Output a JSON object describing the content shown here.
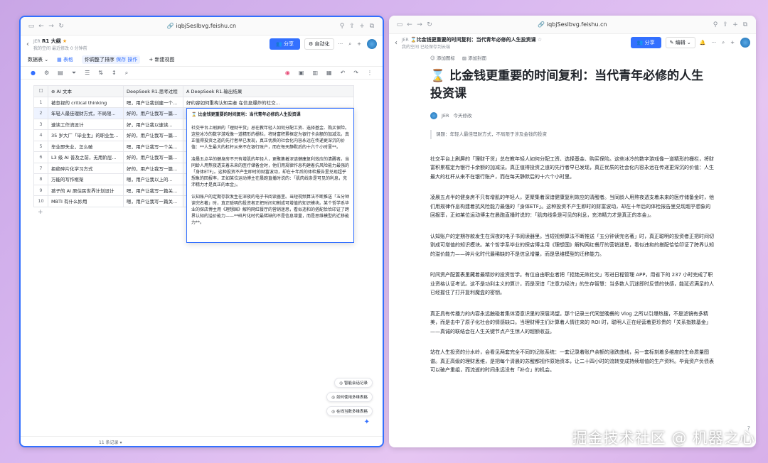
{
  "left": {
    "url": "iqbjSeslbvg.feishu.cn",
    "title": "R1 大纲",
    "crumb1": "JER",
    "crumb2": "最近修改 0 分钟前",
    "crumb3": "我的空间",
    "share": "分享",
    "automation": "自动化",
    "db_label": "数据表",
    "view": "表格",
    "sort_note": "你调整了排序",
    "save": "保存",
    "action": "操作",
    "new_view": "+ 新建视图",
    "headers": [
      "AI 文本",
      "DeepSeek R1.思考过程",
      "DeepSeek R1.输出结果"
    ],
    "rows": [
      {
        "n": "1",
        "a": "被忽视的 critical thinking",
        "b": "嗯，用户让我创建一个...",
        "c": "好约容如何重构认知完者 在信息爆炸的社交..."
      },
      {
        "n": "2",
        "a": "年轻人最佳理财方式，不局限...",
        "b": "好的，用户让我写一篇...",
        "c": ""
      },
      {
        "n": "3",
        "a": "速读工作流设计",
        "b": "好，用户让我以速读...",
        "c": ""
      },
      {
        "n": "4",
        "a": "35 岁大厂「毕业生」的职业生...",
        "b": "好的，用户让我写一篇...",
        "c": ""
      },
      {
        "n": "5",
        "a": "毕业即失业，怎么破",
        "b": "嗯，用户让我写一个关...",
        "c": ""
      },
      {
        "n": "6",
        "a": "L3 级 AI 普及之前，无用阶层...",
        "b": "好的，用户让我写一篇...",
        "c": ""
      },
      {
        "n": "7",
        "a": "拒绝碎片化学习方式",
        "b": "好的，用户让我写一篇...",
        "c": ""
      },
      {
        "n": "8",
        "a": "万能的写作框架",
        "b": "嗯，用户让我以上的...",
        "c": ""
      },
      {
        "n": "9",
        "a": "孩子的 AI 原住民世界计划设计",
        "b": "嗯，用户让我写一篇关...",
        "c": ""
      },
      {
        "n": "10",
        "a": "MBTI 有什么妙用",
        "b": "嗯，用户让我写一篇关...",
        "c": ""
      }
    ],
    "popup_title": "比金钱更重要的时间复利：当代青年必修的人生投资课",
    "popup_paras": [
      "社交平台上刷屏的「理财干货」总在教年轻人如何分配工资、选择基金、购买保险。这些冰冷的数字游戏像一道精形的栅栏，将财富积累框定为银行卡余额的加减法。真正值得投资之道的先行者早已发现，真正优质的社会化内容永远在传递更深沉的价值：**人生最大的杠杆从来不在银行账户，而在每天静默后的十六个小时里**。",
      "凌晨五点半的健身房不只有增肌的年轻人，更聚集着深谙健康复利效应的清醒者。当同龄人用熬夜透支着未来的医疗储备金时，他们用规律作息构建着抗风险能力最强的「身体ETF」。这种投资不产生即时的财富波动，却在十年后的体检报告里兑现超乎想象的回报率，正如某位运动博主在晨跑直播时说的：「肌肉线条是可见的利息，充沛精力才是真正的本金」。",
      "认知账户的定期存款发生在深夜的电子书阅读器里。当短视频算法不断推送「五分钟读完名著」时，真正聪明的投资者正把时间切割成可增值的知识模块。某个哲学系毕业的探店博主用《理想国》解构网红餐厅的营销迷思，看似违和的搭配恰恰印证了跨界认知的溢价能力——**碎片化时代最稀缺的不是信息增量，而是思维模型的迁移能力**。"
    ],
    "chip1": "智能会话记录",
    "chip2": "如何使用多维表格",
    "chip3": "在线当数多维表格",
    "record_count": "11 条记录"
  },
  "right": {
    "url": "iqbjSeslbvg.feishu.cn",
    "title": "比金钱更重要的时间复利：当代青年必修的人生投资课",
    "crumb1": "JER",
    "crumb2": "已经保存到云端",
    "crumb3": "我的空间",
    "share": "分享",
    "edit": "编辑",
    "add_icon": "添加图标",
    "add_cover": "添加封面",
    "h1": "比金钱更重要的时间复利：当代青年必修的人生投资课",
    "author": "JER",
    "date": "今天修改",
    "quote": "课题：年轻人最佳理财方式，不局限于涉及金钱的投资",
    "paras": [
      "社交平台上刷屏的「理财干货」总在教年轻人如何分配工资、选择基金、购买保险。这些冰冷的数字游戏像一道精形的栅栏，将财富积累框定为银行卡余额的加减法。真正值得投资之道的先行者早已发现，真正优质的社会化内容永远在传递更深沉的价值：人生最大的杠杆从来不在银行账户，而在每天静默后的十六个小时里。",
      "凌晨五点半的健身房不只有增肌的年轻人，更聚集着深谙健康复利效应的清醒者。当同龄人用熬夜透支着未来的医疗储备金时，他们用规律作息构建着抗风险能力最强的「身体ETF」。这种投资不产生即时的财富波动，却在十年后的体检报告里兑现超乎想象的回报率，正如某位运动博主在晨跑直播时说的：「肌肉线条是可见的利息，充沛精力才是真正的本金」。",
      "认知账户的定期存款发生在深夜的电子书阅读器里。当短视频算法不断推送「五分钟读完名著」时，真正聪明的投资者正把时间切割成可增值的知识模块。某个哲学系毕业的探店博主用《理想国》解构网红餐厅的营销迷思，看似违和的搭配恰恰印证了跨界认知的溢价能力——碎片化时代最稀缺的不是信息增量，而是思维模型的迁移能力。",
      "时间资产配置表里藏着最精妙的投资哲学。有位自由职业者把「拒绝无效社交」写进日程管理 APP，用省下的 237 小时完成了职业资格认证考试。这不是功利主义的算计，而是深谙「注意力经济」的生存智慧：当多数人沉迷即时反馈的快感，能延迟满足的人已经握住了打开复利魔盒的密钥。",
      "真正具有传播力的内容永远触碰着集体潜意识里的深层渴望。那个记录三代同堂晚餐的 Vlog 之所以引爆热搜，不是滤镜有多精美，而是击中了原子化社会的情感缺口。当理财博主们计算着人情往来的 ROI 时，聪明人正在经营着更珍贵的「关系指数基金」——真诚的联结会在人生关键节点产生惊人的超额收益。",
      "站在人生投资的分水岭，会看见两套完全不同的记账系统：一套记录着账户余额的涨跌曲线，另一套标刻着多维度的生命质量图谱。真正高级的理财思维，是把每个清晨的苏醒都视作原始资本，让二十四小时的流转变成持续增值的生产资料。毕竟资产负债表可以破产重组，而流逝的时间永远没有「补仓」的机会。"
    ]
  },
  "watermark": "掘金技术社区 @ 机器之心"
}
